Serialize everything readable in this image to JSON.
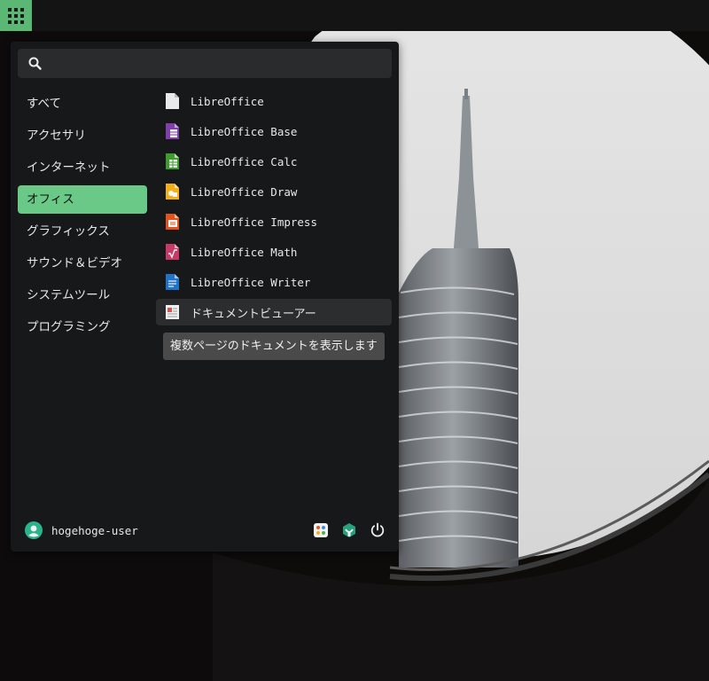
{
  "search": {
    "placeholder": ""
  },
  "categories": [
    {
      "label": "すべて"
    },
    {
      "label": "アクセサリ"
    },
    {
      "label": "インターネット"
    },
    {
      "label": "オフィス"
    },
    {
      "label": "グラフィックス"
    },
    {
      "label": "サウンド＆ビデオ"
    },
    {
      "label": "システムツール"
    },
    {
      "label": "プログラミング"
    }
  ],
  "active_category": "オフィス",
  "apps": [
    {
      "label": "LibreOffice",
      "icon": "libreoffice-icon"
    },
    {
      "label": "LibreOffice Base",
      "icon": "libreoffice-base-icon"
    },
    {
      "label": "LibreOffice Calc",
      "icon": "libreoffice-calc-icon"
    },
    {
      "label": "LibreOffice Draw",
      "icon": "libreoffice-draw-icon"
    },
    {
      "label": "LibreOffice Impress",
      "icon": "libreoffice-impress-icon"
    },
    {
      "label": "LibreOffice Math",
      "icon": "libreoffice-math-icon"
    },
    {
      "label": "LibreOffice Writer",
      "icon": "libreoffice-writer-icon"
    },
    {
      "label": "ドキュメントビューアー",
      "icon": "document-viewer-icon"
    }
  ],
  "tooltip": {
    "text": "複数ページのドキュメントを表示します"
  },
  "user": {
    "name": "hogehoge-user"
  },
  "footer_icons": [
    "settings-icon",
    "software-center-icon",
    "power-icon"
  ],
  "colors": {
    "accent": "#6ac986",
    "panel_button": "#5bb874",
    "menu_bg": "#171819",
    "avatar": "#2bb38c"
  }
}
